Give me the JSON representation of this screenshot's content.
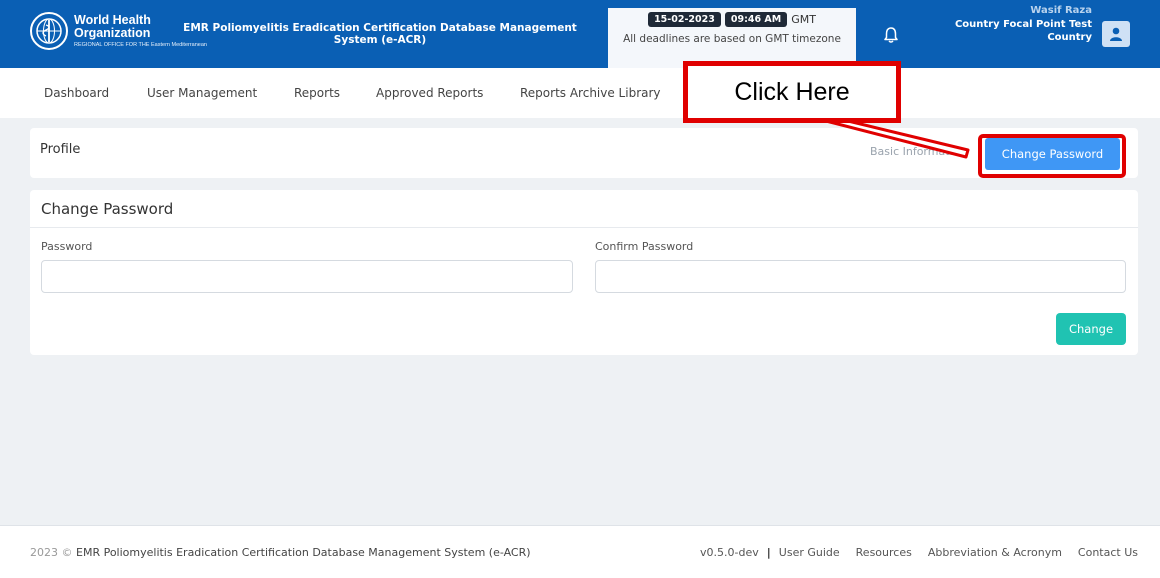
{
  "header": {
    "logo_line1": "World Health",
    "logo_line2": "Organization",
    "logo_line3": "REGIONAL OFFICE FOR THE  Eastern Mediterranean",
    "system_title": "EMR Poliomyelitis Eradication Certification Database Management System (e-ACR)",
    "date": "15-02-2023",
    "time": "09:46 AM",
    "tz": "GMT",
    "deadline_note": "All deadlines are based on GMT timezone",
    "user_name": "Wasif Raza",
    "user_role": "Country Focal Point Test",
    "user_country": "Country"
  },
  "nav": {
    "items": [
      "Dashboard",
      "User Management",
      "Reports",
      "Approved Reports",
      "Reports Archive Library"
    ]
  },
  "callout": {
    "text": "Click Here"
  },
  "profile": {
    "title": "Profile",
    "basic_info": "Basic Information",
    "change_password_button": "Change Password"
  },
  "change_password": {
    "title": "Change Password",
    "password_label": "Password",
    "confirm_label": "Confirm Password",
    "password_value": "",
    "confirm_value": "",
    "submit_label": "Change"
  },
  "footer": {
    "year": "2023 ©",
    "system": "EMR Poliomyelitis Eradication Certification Database Management System (e-ACR)",
    "version": "v0.5.0-dev",
    "separator": "|",
    "links": [
      "User Guide",
      "Resources",
      "Abbreviation & Acronym",
      "Contact Us"
    ]
  },
  "colors": {
    "header_bg": "#0a5fb4",
    "primary_button": "#3f97f5",
    "success_button": "#20c3b2",
    "callout_red": "#e00000"
  },
  "icons": {
    "logo": "who-emblem-icon",
    "bell": "bell-icon",
    "avatar": "user-icon"
  }
}
